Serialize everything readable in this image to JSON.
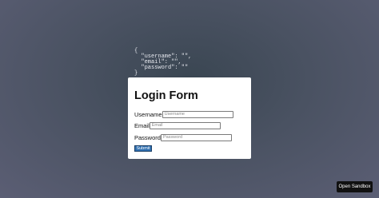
{
  "json_preview": "{\n  \"username\": \"\",\n  \"email\": \"\",\n  \"password\": \"\"\n}",
  "form": {
    "title": "Login Form",
    "fields": [
      {
        "label": "Username",
        "placeholder": "Username",
        "value": ""
      },
      {
        "label": "Email",
        "placeholder": "Email",
        "value": ""
      },
      {
        "label": "Password",
        "placeholder": "Password",
        "value": ""
      }
    ],
    "submit_label": "Submit"
  },
  "sandbox_button_label": "Open Sandbox"
}
